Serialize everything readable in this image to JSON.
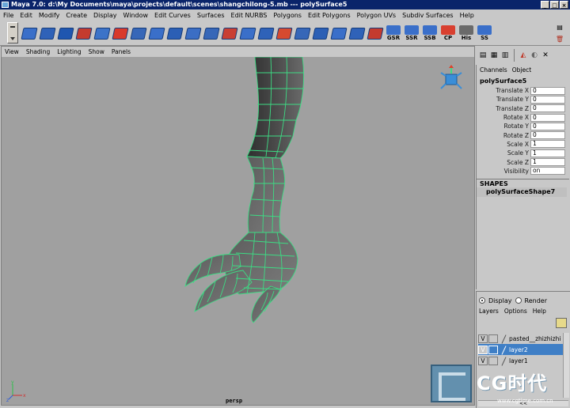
{
  "window": {
    "title": "Maya 7.0: d:\\My Documents\\maya\\projects\\default\\scenes\\shangchilong-5.mb  ---  polySurface5",
    "buttons": [
      "_",
      "□",
      "×"
    ]
  },
  "menubar": [
    "File",
    "Edit",
    "Modify",
    "Create",
    "Display",
    "Window",
    "Edit Curves",
    "Surfaces",
    "Edit NURBS",
    "Polygons",
    "Edit Polygons",
    "Polygon UVs",
    "Subdiv Surfaces",
    "Help"
  ],
  "shelf": {
    "tools": [
      {
        "icon": "poly-cube-icon",
        "color": "#3a6fc9"
      },
      {
        "icon": "poly-plane-icon",
        "color": "#2f62b8"
      },
      {
        "icon": "poly-sphere-icon",
        "color": "#1f56b0"
      },
      {
        "icon": "poly-cylinder-icon",
        "color": "#c43b2f"
      },
      {
        "icon": "poly-torus-icon",
        "color": "#3c73c8"
      },
      {
        "icon": "combine-icon",
        "color": "#d93a2b"
      },
      {
        "icon": "extrude-face-icon",
        "color": "#3767b8"
      },
      {
        "icon": "split-poly-icon",
        "color": "#3a6fc9"
      },
      {
        "icon": "wedge-face-icon",
        "color": "#2b5fb5"
      },
      {
        "icon": "cut-faces-icon",
        "color": "#3b6ec4"
      },
      {
        "icon": "merge-vertices-icon",
        "color": "#3767b8"
      },
      {
        "icon": "bevel-icon",
        "color": "#c93f33"
      },
      {
        "icon": "smooth-icon",
        "color": "#3a6fc9"
      },
      {
        "icon": "subdivide-icon",
        "color": "#2f62b8"
      },
      {
        "icon": "triangulate-icon",
        "color": "#d64a30"
      },
      {
        "icon": "quadrangulate-icon",
        "color": "#3767b8"
      },
      {
        "icon": "append-polygon-icon",
        "color": "#2b5fb5"
      },
      {
        "icon": "mirror-icon",
        "color": "#3a6fc9"
      },
      {
        "icon": "collapse-icon",
        "color": "#2f62b8"
      },
      {
        "icon": "delete-edge-icon",
        "color": "#c43b2f"
      }
    ],
    "labeled": [
      {
        "icon": "gsr-icon",
        "label": "GSR"
      },
      {
        "icon": "ssr-icon",
        "label": "SSR"
      },
      {
        "icon": "ssb-icon",
        "label": "SSB"
      },
      {
        "icon": "cp-icon",
        "label": "CP"
      },
      {
        "icon": "history-icon",
        "label": "His"
      },
      {
        "icon": "ss-icon",
        "label": "SS"
      }
    ],
    "end_icons": [
      "shelf-menu-icon",
      "trash-icon"
    ]
  },
  "panel_menu": [
    "View",
    "Shading",
    "Lighting",
    "Show",
    "Panels"
  ],
  "viewport": {
    "camera": "persp",
    "background": "#a0a0a0",
    "wire_color": "#3ddc84"
  },
  "channel_box": {
    "menu": [
      "Channels",
      "Object"
    ],
    "object_name": "polySurface5",
    "attributes": [
      {
        "label": "Translate X",
        "value": "0"
      },
      {
        "label": "Translate Y",
        "value": "0"
      },
      {
        "label": "Translate Z",
        "value": "0"
      },
      {
        "label": "Rotate X",
        "value": "0"
      },
      {
        "label": "Rotate Y",
        "value": "0"
      },
      {
        "label": "Rotate Z",
        "value": "0"
      },
      {
        "label": "Scale X",
        "value": "1"
      },
      {
        "label": "Scale Y",
        "value": "1"
      },
      {
        "label": "Scale Z",
        "value": "1"
      },
      {
        "label": "Visibility",
        "value": "on"
      }
    ],
    "shapes_header": "SHAPES",
    "shape_name": "polySurfaceShape7"
  },
  "layer_editor": {
    "display_label": "Display",
    "render_label": "Render",
    "menu": [
      "Layers",
      "Options",
      "Help"
    ],
    "layers": [
      {
        "vis": "V",
        "name": "pasted__zhizhizhi",
        "selected": false
      },
      {
        "vis": "V",
        "name": "layer2",
        "selected": true
      },
      {
        "vis": "V",
        "name": "layer1",
        "selected": false
      }
    ],
    "scroll_arrows": "<<"
  },
  "watermark": {
    "title": "CG时代",
    "url": "www.cgtime.com.cn"
  }
}
